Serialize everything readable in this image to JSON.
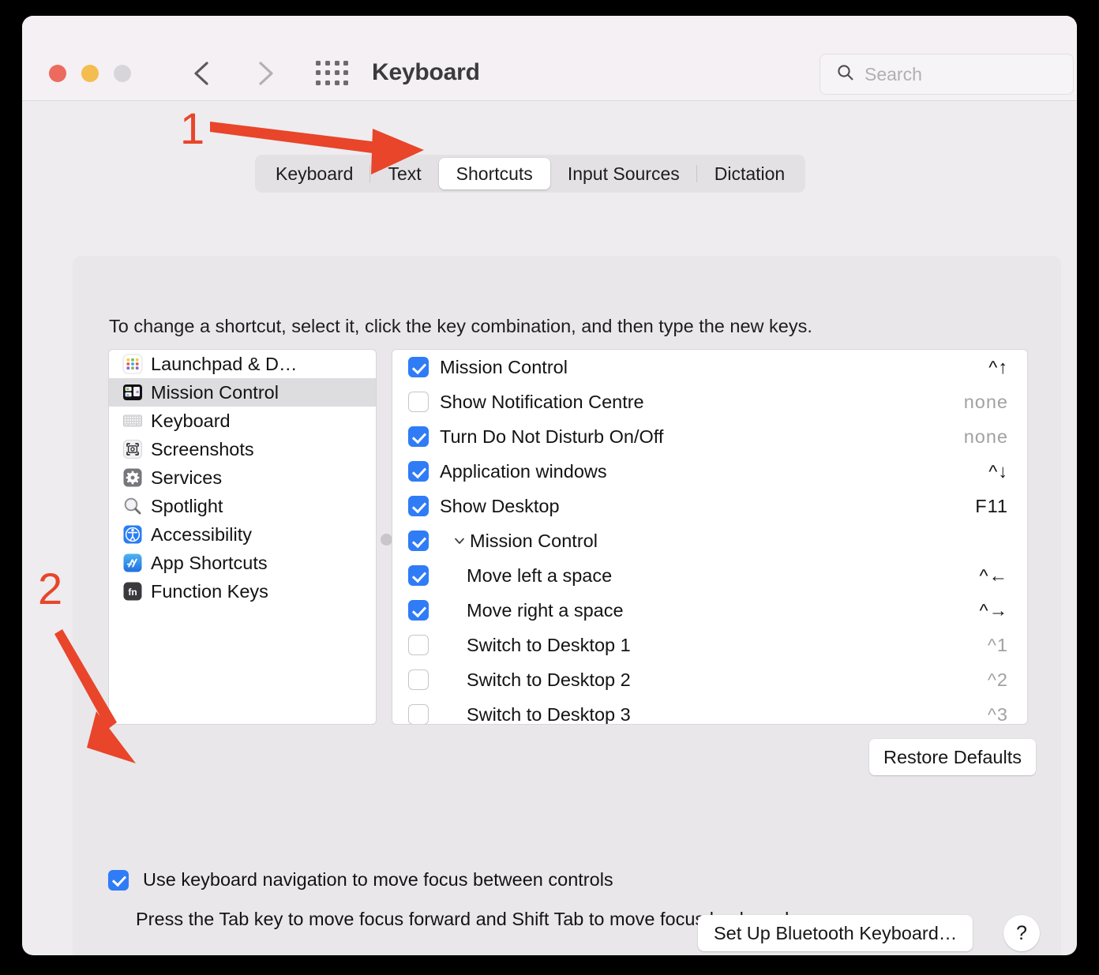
{
  "window": {
    "title": "Keyboard",
    "traffic_lights": [
      "close",
      "minimize",
      "zoom"
    ],
    "search": {
      "placeholder": "Search",
      "value": ""
    }
  },
  "tabs": [
    {
      "label": "Keyboard",
      "selected": false
    },
    {
      "label": "Text",
      "selected": false
    },
    {
      "label": "Shortcuts",
      "selected": true
    },
    {
      "label": "Input Sources",
      "selected": false
    },
    {
      "label": "Dictation",
      "selected": false
    }
  ],
  "panel": {
    "hint": "To change a shortcut, select it, click the key combination, and then type the new keys.",
    "restore_defaults": "Restore Defaults"
  },
  "sidebar": {
    "items": [
      {
        "label": "Launchpad & D…",
        "icon": "launchpad-icon",
        "selected": false
      },
      {
        "label": "Mission Control",
        "icon": "mission-control-icon",
        "selected": true
      },
      {
        "label": "Keyboard",
        "icon": "keyboard-icon",
        "selected": false
      },
      {
        "label": "Screenshots",
        "icon": "screenshots-icon",
        "selected": false
      },
      {
        "label": "Services",
        "icon": "services-gear-icon",
        "selected": false
      },
      {
        "label": "Spotlight",
        "icon": "spotlight-magnifier-icon",
        "selected": false
      },
      {
        "label": "Accessibility",
        "icon": "accessibility-icon",
        "selected": false
      },
      {
        "label": "App Shortcuts",
        "icon": "app-shortcuts-icon",
        "selected": false
      },
      {
        "label": "Function Keys",
        "icon": "function-keys-icon",
        "selected": false
      }
    ]
  },
  "shortcuts": {
    "rows": [
      {
        "name": "Mission Control",
        "key": "^↑",
        "checked": true,
        "child": false,
        "group": false
      },
      {
        "name": "Show Notification Centre",
        "key": "none",
        "checked": false,
        "child": false,
        "group": false
      },
      {
        "name": "Turn Do Not Disturb On/Off",
        "key": "none",
        "checked": true,
        "child": false,
        "group": false
      },
      {
        "name": "Application windows",
        "key": "^↓",
        "checked": true,
        "child": false,
        "group": false
      },
      {
        "name": "Show Desktop",
        "key": "F11",
        "checked": true,
        "child": false,
        "group": false
      },
      {
        "name": "Mission Control",
        "key": "",
        "checked": true,
        "child": false,
        "group": true
      },
      {
        "name": "Move left a space",
        "key": "^←",
        "checked": true,
        "child": true,
        "group": false
      },
      {
        "name": "Move right a space",
        "key": "^→",
        "checked": true,
        "child": true,
        "group": false
      },
      {
        "name": "Switch to Desktop 1",
        "key": "^1",
        "checked": false,
        "child": true,
        "group": false
      },
      {
        "name": "Switch to Desktop 2",
        "key": "^2",
        "checked": false,
        "child": true,
        "group": false
      },
      {
        "name": "Switch to Desktop 3",
        "key": "^3",
        "checked": false,
        "child": true,
        "group": false
      }
    ]
  },
  "keyboard_navigation": {
    "checked": true,
    "label": "Use keyboard navigation to move focus between controls",
    "description": "Press the Tab key to move focus forward and Shift Tab to move focus backward."
  },
  "footer": {
    "bluetooth_button": "Set Up Bluetooth Keyboard…",
    "help_button": "?"
  },
  "annotations": {
    "color": "#e8452a",
    "markers": [
      {
        "number": "1",
        "points_to": "tab-shortcuts"
      },
      {
        "number": "2",
        "points_to": "keyboard-navigation-checkbox"
      }
    ]
  }
}
